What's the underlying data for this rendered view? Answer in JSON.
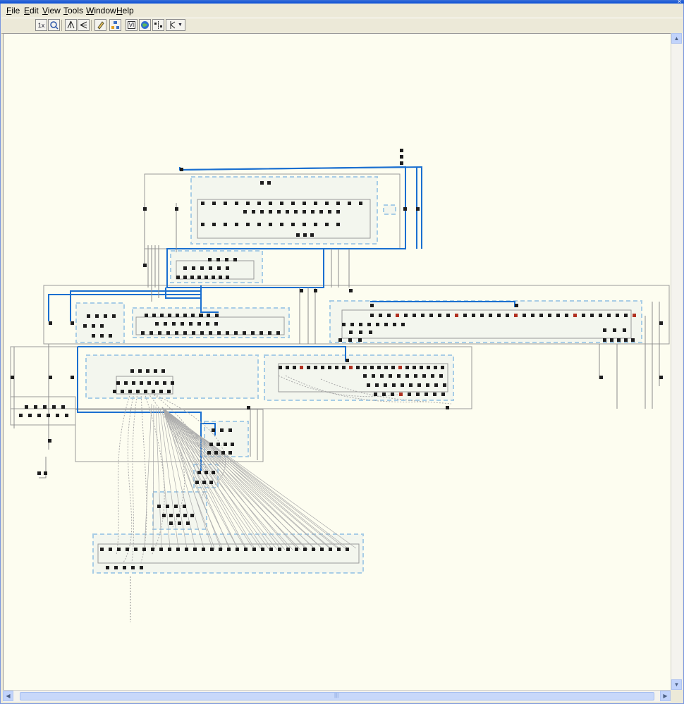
{
  "window": {
    "close_glyph": "×"
  },
  "menu": [
    {
      "key": "F",
      "rest": "ile"
    },
    {
      "key": "E",
      "rest": "dit"
    },
    {
      "key": "V",
      "rest": "iew"
    },
    {
      "key": "T",
      "rest": "ools"
    },
    {
      "key": "W",
      "rest": "indow"
    },
    {
      "key": "H",
      "rest": "elp"
    }
  ],
  "toolbar": {
    "zoom_label": "1x",
    "tools": [
      "zoom-1x-icon",
      "zoom-fit-icon",
      "tree-layout-icon",
      "branch-layout-icon",
      "edit-pencil-icon",
      "hierarchy-icon",
      "vi-icon",
      "globe-icon",
      "split-icon",
      "filter-dropdown-icon"
    ],
    "vi_label": "VI"
  },
  "canvas": {
    "background": "#fdfdf0",
    "accent": "#1a6fd0",
    "cluster_border": "#a8cde6",
    "wire": "#8c8c8c"
  },
  "scroll": {
    "up": "▲",
    "down": "▼",
    "grip": "|||"
  }
}
